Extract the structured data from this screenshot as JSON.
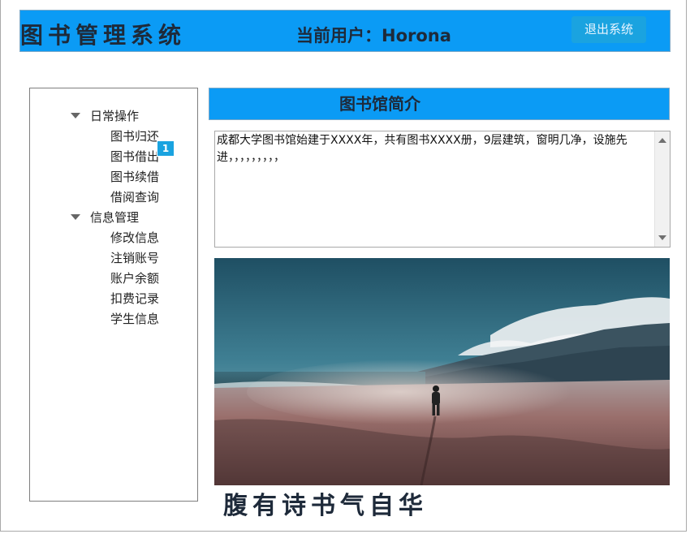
{
  "header": {
    "title": "图书管理系统",
    "current_user": "当前用户：Horona",
    "logout_label": "退出系统"
  },
  "sidebar": {
    "groups": [
      {
        "label": "日常操作",
        "items": [
          {
            "label": "图书归还"
          },
          {
            "label": "图书借出"
          },
          {
            "label": "图书续借"
          },
          {
            "label": "借阅查询"
          }
        ]
      },
      {
        "label": "信息管理",
        "items": [
          {
            "label": "修改信息"
          },
          {
            "label": "注销账号"
          },
          {
            "label": "账户余额"
          },
          {
            "label": "扣费记录"
          },
          {
            "label": "学生信息"
          }
        ]
      }
    ],
    "badge": "1"
  },
  "main": {
    "panel_title": "图书馆简介",
    "intro_text": "成都大学图书馆始建于XXXX年，共有图书XXXX册，9层建筑，窗明几净，设施先进，，，，，，，，，",
    "motto": "腹有诗书气自华"
  },
  "colors": {
    "header_bg": "#0b9bf5",
    "button_bg": "#1aa3e0",
    "title_text": "#1e2a3a"
  }
}
